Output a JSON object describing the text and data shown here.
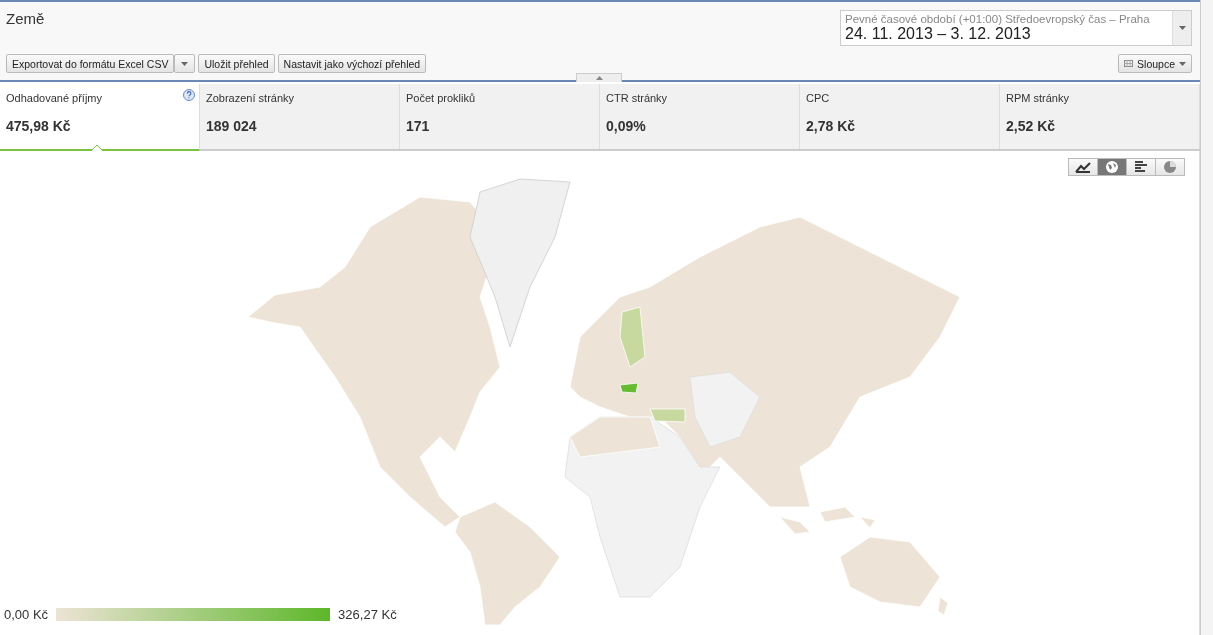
{
  "header": {
    "title": "Země"
  },
  "date_range": {
    "caption": "Pevné časové období (+01:00) Středoevropský čas – Praha",
    "value": "24. 11. 2013 – 3. 12. 2013"
  },
  "toolbar": {
    "export_button": "Exportovat do formátu Excel CSV",
    "save_button": "Uložit přehled",
    "default_button": "Nastavit jako výchozí přehled",
    "columns_button": "Sloupce"
  },
  "metrics": [
    {
      "label": "Odhadované příjmy",
      "value": "475,98 Kč",
      "selected": true,
      "help": true
    },
    {
      "label": "Zobrazení stránky",
      "value": "189 024",
      "selected": false,
      "help": false
    },
    {
      "label": "Počet prokliků",
      "value": "171",
      "selected": false,
      "help": false
    },
    {
      "label": "CTR stránky",
      "value": "0,09%",
      "selected": false,
      "help": false
    },
    {
      "label": "CPC",
      "value": "2,78 Kč",
      "selected": false,
      "help": false
    },
    {
      "label": "RPM stránky",
      "value": "2,52 Kč",
      "selected": false,
      "help": false
    }
  ],
  "view_buttons": [
    {
      "kind": "line",
      "selected": false
    },
    {
      "kind": "map",
      "selected": true
    },
    {
      "kind": "bar",
      "selected": false
    },
    {
      "kind": "pie",
      "selected": false
    }
  ],
  "legend": {
    "min": "0,00 Kč",
    "max": "326,27 Kč"
  }
}
